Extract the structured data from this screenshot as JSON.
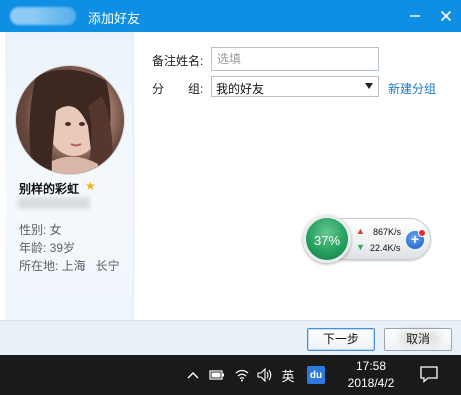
{
  "window": {
    "title": "添加好友",
    "minimize_icon": "minimize-icon",
    "close_icon": "close-icon"
  },
  "profile": {
    "nickname": "别样的彩虹",
    "gender": "性别: 女",
    "age": "年龄: 39岁",
    "location_label": "所在地: 上海",
    "location_city": "长宁"
  },
  "form": {
    "remark_label": "备注姓名:",
    "remark_placeholder": "选填",
    "remark_value": "",
    "group_label_a": "分",
    "group_label_b": "组:",
    "group_selected": "我的好友",
    "new_group_link": "新建分组"
  },
  "speed_widget": {
    "percent": "37%",
    "upload_rate": "867K/s",
    "download_rate": "22.4K/s"
  },
  "buttons": {
    "next": "下一步",
    "cancel": "取消"
  },
  "taskbar": {
    "ime": "英",
    "baidu": "du",
    "time": "17:58",
    "date": "2018/4/2"
  },
  "colors": {
    "titlebar": "#0e8fe3",
    "link": "#1a78c2",
    "speed_green": "#27a05e",
    "taskbar": "#1a1a1a"
  }
}
